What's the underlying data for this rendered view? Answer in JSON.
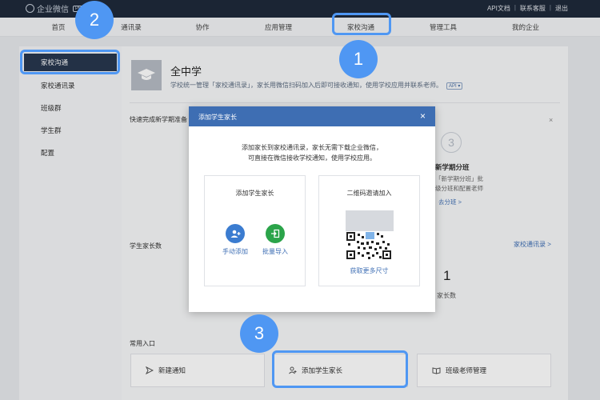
{
  "topbar": {
    "brand": "企业微信",
    "brand_badge": "PRO",
    "links": [
      "API文档",
      "联系客服",
      "退出"
    ],
    "separator": "|"
  },
  "nav": {
    "items": [
      "首页",
      "通讯录",
      "协作",
      "应用管理",
      "家校沟通",
      "管理工具",
      "我的企业"
    ],
    "active_index": 4
  },
  "sidebar": {
    "active": "家校沟通",
    "items": [
      "家校通讯录",
      "班级群",
      "学生群",
      "配置"
    ]
  },
  "header": {
    "school_name": "全中学",
    "description": "学校统一管理「家校通讯录」，家长用微信扫码加入后即可接收通知，使用学校应用并联系老师。",
    "api_tag": "API"
  },
  "quick_setup": {
    "title": "快速完成新学期准备",
    "close_icon": "×",
    "step_number": "3",
    "step_title": "新学期分班",
    "step_desc_1": "「新学期分班」批",
    "step_desc_2": "级分班和配置老师",
    "step_link": "去分班 >"
  },
  "parents": {
    "label": "学生家长数",
    "contacts_link": "家校通讯录 >",
    "count": "1",
    "count_label": "家长数"
  },
  "common": {
    "label": "常用入口",
    "entries": [
      "新建通知",
      "添加学生家长",
      "班级老师管理"
    ]
  },
  "modal": {
    "title": "添加学生家长",
    "close": "×",
    "intro_1": "添加家长到家校通讯录，家长无需下载企业微信，",
    "intro_2": "可直接在微信接收学校通知，使用学校应用。",
    "left_card_title": "添加学生家长",
    "manual_add": "手动添加",
    "batch_import": "批量导入",
    "right_card_title": "二维码邀请加入",
    "more_sizes": "获取更多尺寸"
  },
  "annotations": {
    "labels": [
      "1",
      "2",
      "3"
    ],
    "color": "#4f97f3"
  },
  "colors": {
    "topbar": "#1f2a3a",
    "modal_header": "#3e6eb3",
    "sidebar_active": "#27374e",
    "link": "#3f6fb5",
    "manual_add": "#3b7cd0",
    "batch_import": "#2ba44a"
  }
}
